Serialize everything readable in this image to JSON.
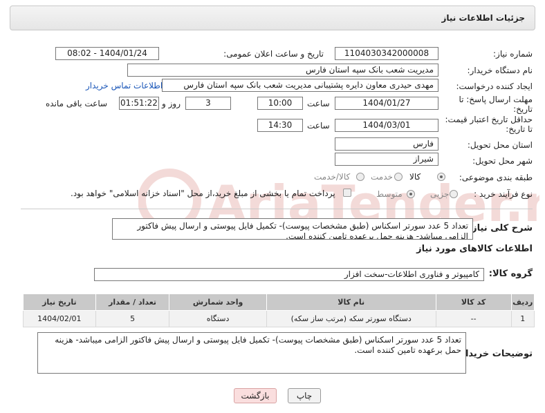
{
  "header": {
    "title": "جزئیات اطلاعات نیاز"
  },
  "form": {
    "need_number_label": "شماره نیاز:",
    "need_number": "1104030342000008",
    "announce_label": "تاریخ و ساعت اعلان عمومی:",
    "announce_value": "1404/01/24 - 08:02",
    "buyer_org_label": "نام دستگاه خریدار:",
    "buyer_org": "مدیریت شعب بانک سپه استان فارس",
    "requester_label": "ایجاد کننده درخواست:",
    "requester": "مهدی حیدری معاون دایره پشتیبانی مدیریت شعب بانک سپه استان فارس",
    "contact_link": "اطلاعات تماس خریدار",
    "reply_deadline_label": "مهلت ارسال پاسخ: تا تاریخ:",
    "reply_date": "1404/01/27",
    "time_label": "ساعت",
    "reply_time": "10:00",
    "days_value": "3",
    "days_label": "روز و",
    "remaining_time": "01:51:22",
    "remaining_label": "ساعت باقی مانده",
    "price_deadline_label": "حداقل تاریخ اعتبار قیمت: تا تاریخ:",
    "price_date": "1404/03/01",
    "price_time": "14:30",
    "province_label": "استان محل تحویل:",
    "province": "فارس",
    "city_label": "شهر محل تحویل:",
    "city": "شیراز",
    "category_label": "طبقه بندی موضوعی:",
    "category_options": [
      "کالا",
      "خدمت",
      "کالا/خدمت"
    ],
    "process_label": "نوع فرآیند خرید :",
    "process_options": [
      "جزیی",
      "متوسط"
    ],
    "payment_note": "پرداخت تمام یا بخشی از مبلغ خرید،از محل \"اسناد خزانه اسلامی\" خواهد بود."
  },
  "description": {
    "label": "شرح کلی نیاز:",
    "text": "تعداد 5 عدد سورتر اسکناس (طبق مشخصات پیوست)- تکمیل فایل پیوستی و ارسال پیش فاکتور الزامی میباشد- هزینه حمل برعهده تامین کننده است."
  },
  "goods_section": {
    "title": "اطلاعات کالاهای مورد نیاز",
    "group_label": "گروه کالا:",
    "group_value": "کامپیوتر و فناوری اطلاعات-سخت افزار"
  },
  "table": {
    "headers": [
      "ردیف",
      "کد کالا",
      "نام کالا",
      "واحد شمارش",
      "تعداد / مقدار",
      "تاریخ نیاز"
    ],
    "rows": [
      {
        "row": "1",
        "code": "--",
        "name": "دستگاه سورتر سکه (مرتب ساز سکه)",
        "unit": "دستگاه",
        "qty": "5",
        "date": "1404/02/01"
      }
    ]
  },
  "buyer_notes": {
    "label": "توضیحات خریدار:",
    "text": "تعداد 5 عدد سورتر اسکناس (طبق مشخصات پیوست)- تکمیل فایل پیوستی و ارسال پیش فاکتور الزامی میباشد- هزینه حمل برعهده تامین کننده است."
  },
  "buttons": {
    "print": "چاپ",
    "back": "بازگشت"
  },
  "watermark": {
    "text": "AriaTender.net"
  }
}
